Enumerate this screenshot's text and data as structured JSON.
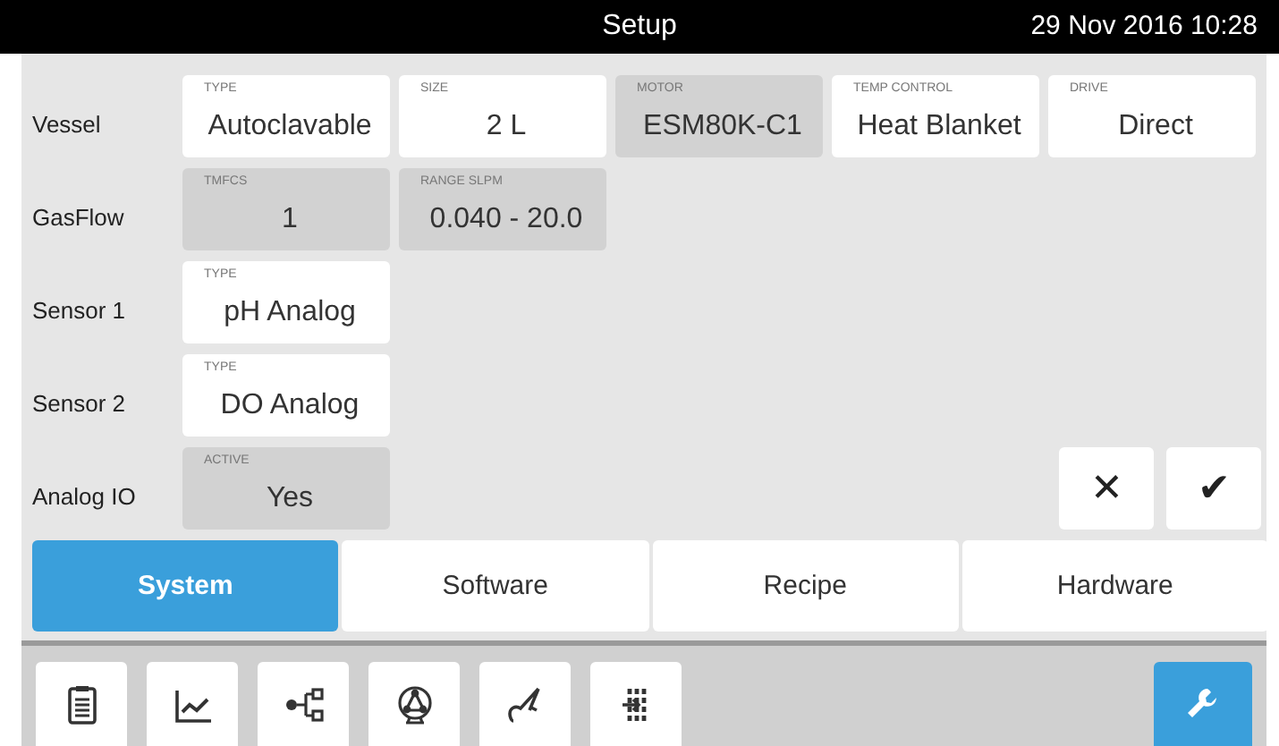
{
  "window": {
    "title": "Setup",
    "datetime": "29 Nov 2016  10:28"
  },
  "rows": [
    {
      "label": "Vessel",
      "fields": [
        {
          "caption": "TYPE",
          "value": "Autoclavable",
          "editable": true
        },
        {
          "caption": "SIZE",
          "value": "2 L",
          "editable": true
        },
        {
          "caption": "MOTOR",
          "value": "ESM80K-C1",
          "editable": false
        },
        {
          "caption": "TEMP CONTROL",
          "value": "Heat Blanket",
          "editable": true
        },
        {
          "caption": "DRIVE",
          "value": "Direct",
          "editable": true
        }
      ]
    },
    {
      "label": "GasFlow",
      "fields": [
        {
          "caption": "TMFCS",
          "value": "1",
          "editable": false
        },
        {
          "caption": "RANGE  SLPM",
          "value": "0.040 - 20.0",
          "editable": false
        }
      ]
    },
    {
      "label": "Sensor 1",
      "fields": [
        {
          "caption": "TYPE",
          "value": "pH Analog",
          "editable": true
        }
      ]
    },
    {
      "label": "Sensor 2",
      "fields": [
        {
          "caption": "TYPE",
          "value": "DO Analog",
          "editable": true
        }
      ]
    },
    {
      "label": "Analog IO",
      "fields": [
        {
          "caption": "ACTIVE",
          "value": "Yes",
          "editable": false
        }
      ]
    }
  ],
  "actions": [
    "✕",
    "✔"
  ],
  "tabs": [
    {
      "label": "System",
      "selected": true
    },
    {
      "label": "Software",
      "selected": false
    },
    {
      "label": "Recipe",
      "selected": false
    },
    {
      "label": "Hardware",
      "selected": false
    }
  ],
  "toolbar": [
    {
      "kind": "clipboard",
      "selected": false
    },
    {
      "kind": "chart",
      "selected": false
    },
    {
      "kind": "flow",
      "selected": false
    },
    {
      "kind": "pump",
      "selected": false
    },
    {
      "kind": "probe",
      "selected": false
    },
    {
      "kind": "connector",
      "selected": false
    },
    {
      "kind": "wrench",
      "selected": true
    }
  ]
}
